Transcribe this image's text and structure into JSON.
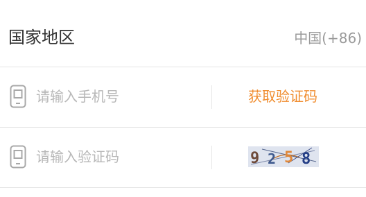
{
  "region": {
    "label": "国家地区",
    "value": "中国(+86)"
  },
  "phone": {
    "icon": "mobile-phone-icon",
    "placeholder": "请输入手机号",
    "sms_button_label": "获取验证码"
  },
  "code": {
    "icon": "mobile-phone-icon",
    "placeholder": "请输入验证码",
    "captcha_text": [
      "9",
      "2",
      "5",
      "8"
    ]
  },
  "colors": {
    "accent": "#f08c2e",
    "placeholder": "#b8b8b8",
    "divider": "#e3e3e3"
  }
}
